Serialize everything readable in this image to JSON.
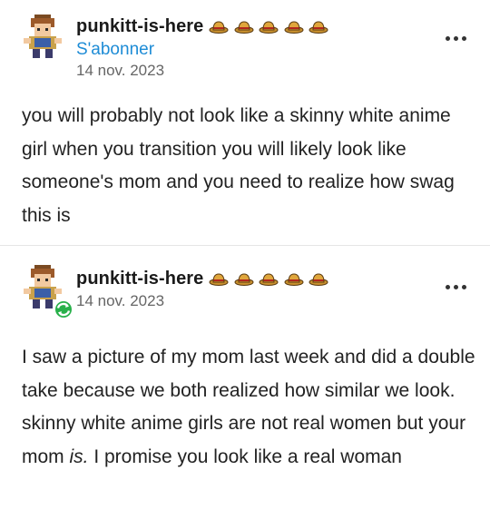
{
  "posts": [
    {
      "username": "punkitt-is-here",
      "follow_label": "S'abonner",
      "date": "14 nov. 2023",
      "badge_icons": [
        "hat-icon",
        "hat-icon",
        "hat-icon",
        "hat-icon",
        "hat-icon"
      ],
      "body": "you will probably not look like a skinny white anime girl when you transition you will likely look like someone's mom and you need to realize how swag this is"
    },
    {
      "username": "punkitt-is-here",
      "date": "14 nov. 2023",
      "badge_icons": [
        "hat-icon",
        "hat-icon",
        "hat-icon",
        "hat-icon",
        "hat-icon"
      ],
      "body_before": "I saw a picture of my mom last week and did a double take because we both realized how similar we look. skinny white anime girls are not real women but your mom ",
      "body_emphasis": "is.",
      "body_after": " I promise you look like a real woman"
    }
  ],
  "colors": {
    "link": "#1e8cd6",
    "reblog_badge": "#28b04a",
    "hat": "#c8902e"
  }
}
